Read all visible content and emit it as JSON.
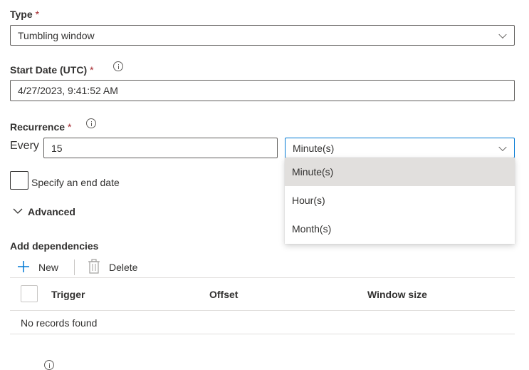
{
  "type_field": {
    "label": "Type",
    "required_mark": "*",
    "value": "Tumbling window"
  },
  "start_date": {
    "label": "Start Date (UTC)",
    "required_mark": "*",
    "value": "4/27/2023, 9:41:52 AM"
  },
  "recurrence": {
    "label": "Recurrence",
    "required_mark": "*",
    "every_label": "Every",
    "interval_value": "15",
    "unit_value": "Minute(s)",
    "unit_options": [
      "Minute(s)",
      "Hour(s)",
      "Month(s)"
    ],
    "selected_option_index": 0
  },
  "end_date": {
    "checkbox_label": "Specify an end date",
    "checked": false
  },
  "advanced": {
    "label": "Advanced"
  },
  "dependencies": {
    "title": "Add dependencies",
    "toolbar": {
      "new_label": "New",
      "delete_label": "Delete"
    },
    "columns": [
      "Trigger",
      "Offset",
      "Window size"
    ],
    "empty_text": "No records found"
  },
  "colors": {
    "required": "#a4262c",
    "focus_border": "#0078d4",
    "selected_option_bg": "#e1dfdd",
    "text": "#323130",
    "add_icon": "#0078d4"
  }
}
